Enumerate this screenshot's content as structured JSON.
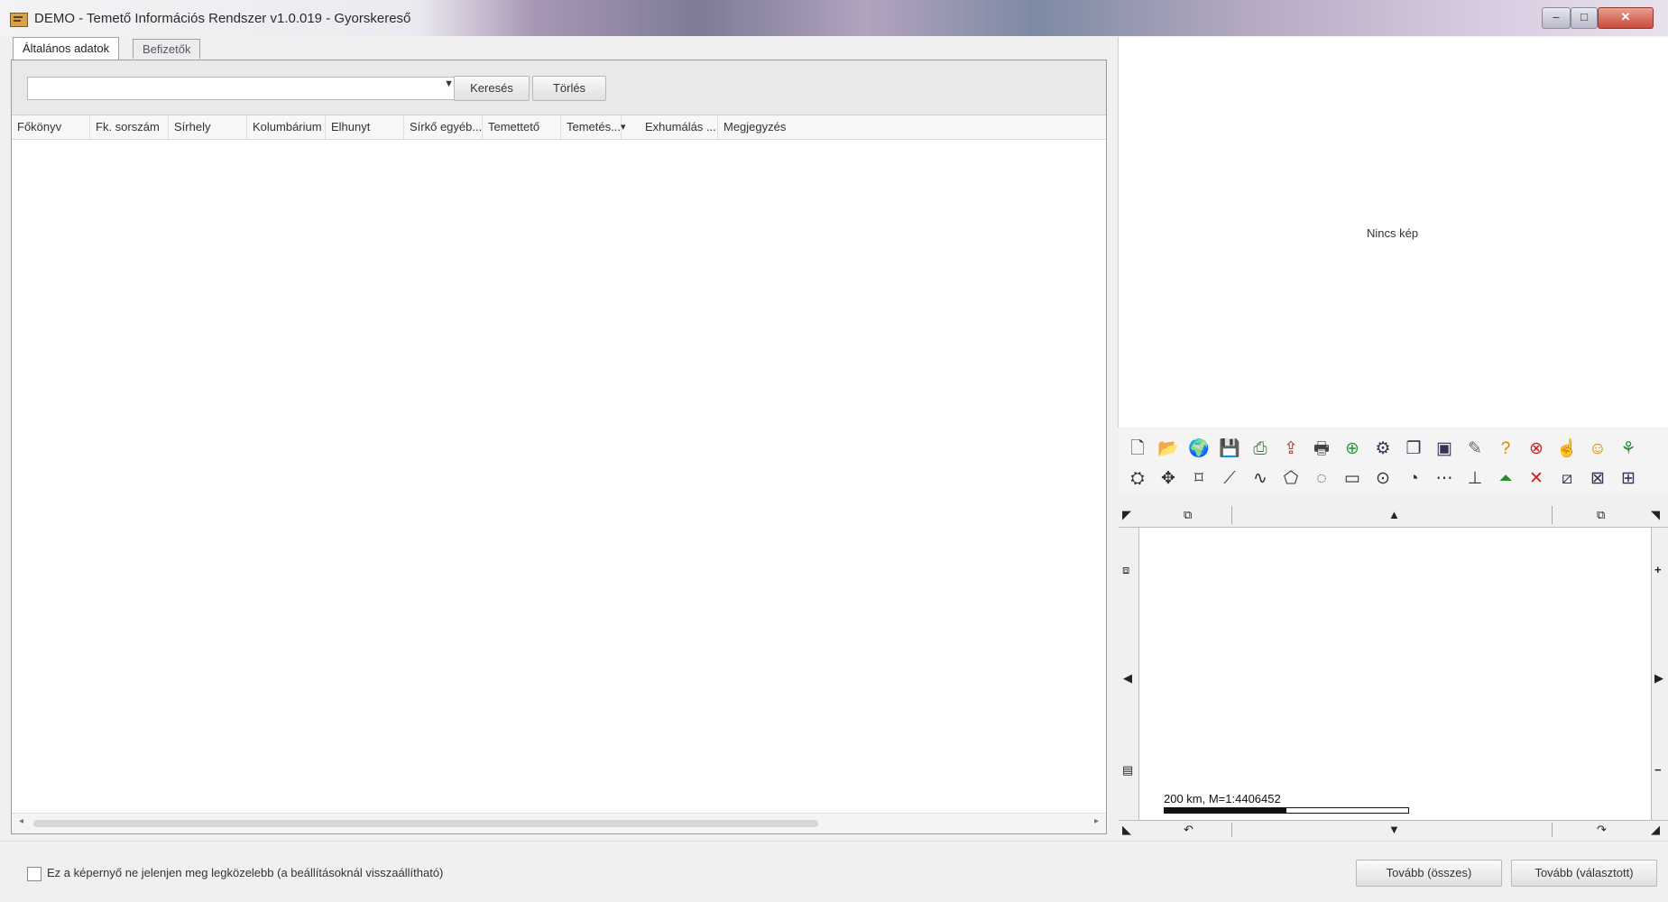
{
  "window": {
    "title": "DEMO - Temető Információs Rendszer v1.0.019 - Gyorskereső",
    "min_glyph": "–",
    "max_glyph": "□",
    "close_glyph": "✕"
  },
  "tabs": [
    {
      "label": "Általános adatok",
      "active": true
    },
    {
      "label": "Befizetők",
      "active": false
    }
  ],
  "search": {
    "value": "",
    "search_button": "Keresés",
    "clear_button": "Törlés"
  },
  "table": {
    "columns": [
      "Főkönyv",
      "Fk. sorszám",
      "Sírhely",
      "Kolumbárium",
      "Elhunyt",
      "Sírkő egyéb...",
      "Temettető",
      "Temetés...",
      "Exhumálás ...",
      "Megjegyzés"
    ],
    "sort_indicator": "▾",
    "rows": []
  },
  "image_panel": {
    "placeholder": "Nincs kép"
  },
  "map_toolbar": {
    "row1": [
      "new-icon",
      "open-icon",
      "globe-icon",
      "save-icon",
      "export-icon",
      "import-icon",
      "print-icon",
      "zoom-in-icon",
      "properties-icon",
      "layers-icon",
      "monitor-icon",
      "pencil-icon",
      "help-icon",
      "cancel-icon",
      "select-icon",
      "smile-icon",
      "settings-icon"
    ],
    "row2": [
      "stamp-icon",
      "move-icon",
      "node-icon",
      "line-icon",
      "curve-icon",
      "polygon-icon",
      "freeform-icon",
      "rectangle-icon",
      "circle-icon",
      "arc-icon",
      "dash-icon",
      "perpendicular-icon",
      "layer-up-icon",
      "delete-icon",
      "edit-box-icon",
      "grid-box-icon",
      "grid-box2-icon"
    ]
  },
  "map": {
    "scale_label": "200 km, M=1:4406452"
  },
  "footer": {
    "checkbox_label": "Ez a képernyő ne jelenjen meg legközelebb (a beállításoknál visszaállítható)",
    "checkbox_checked": false,
    "next_all": "Tovább (összes)",
    "next_selected": "Tovább (választott)"
  }
}
